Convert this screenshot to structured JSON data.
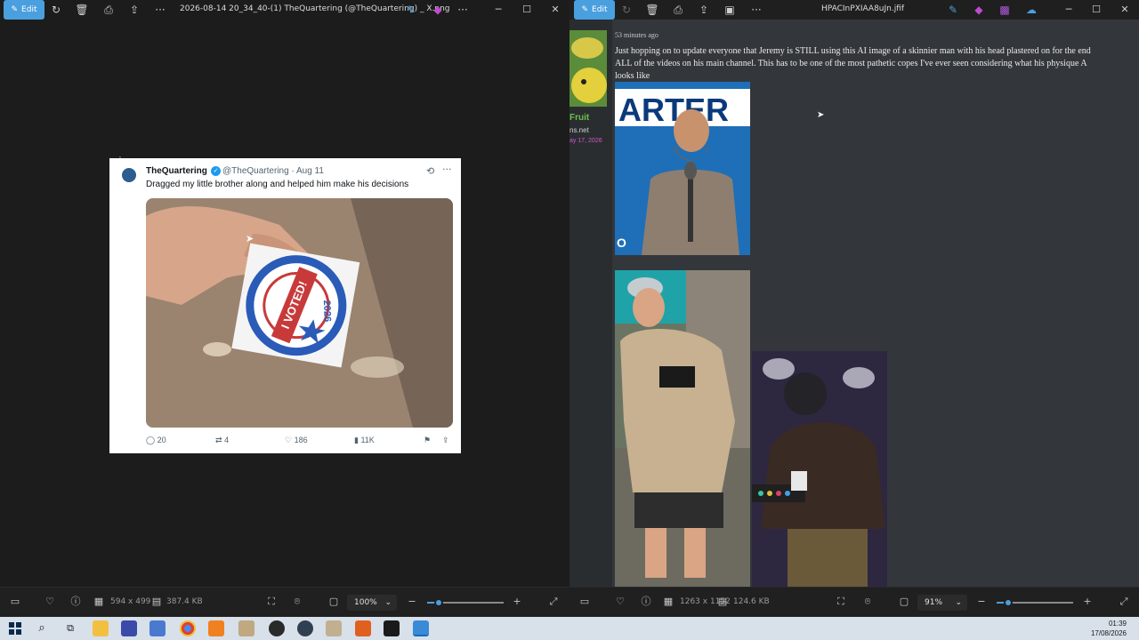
{
  "left_window": {
    "edit_label": "Edit",
    "title": "2026-08-14 20_34_40-(1) TheQuartering (@TheQuartering) _ X.png",
    "bottom": {
      "dimensions": "594 x 499",
      "filesize": "387.4 KB",
      "zoom": "100%"
    }
  },
  "tweet": {
    "name": "TheQuartering",
    "handle_date": "@TheQuartering · Aug 11",
    "text": "Dragged my little brother along and helped him make his decisions",
    "replies": "20",
    "retweets": "4",
    "likes": "186",
    "views": "11K",
    "sticker_text": "I VOTED!",
    "sticker_year": "2026"
  },
  "right_window": {
    "edit_label": "Edit",
    "title": "HPACInPXIAA8uJn.jfif",
    "bottom": {
      "dimensions": "1263 x 1152",
      "filesize": "124.6 KB",
      "zoom": "91%"
    }
  },
  "post": {
    "time": "53 minutes ago",
    "text": "Just hopping on to update everyone that Jeremy is STILL using this AI image of a skinnier man with his head plastered on for the end\nALL of the videos on his main channel. This has to be one of the most pathetic copes I've ever seen considering what his physique A\nlooks like",
    "user_name": "Fruit",
    "user_site": "ns.net",
    "user_date": "ay 17, 2026",
    "banner_text": "ARTER",
    "banner_tail": "O"
  },
  "taskbar": {
    "time": "01:39",
    "date": "17/08/2026"
  },
  "colors": {
    "accent": "#4a9fde",
    "verified": "#1d9bf0",
    "username": "#6cc04a",
    "user_date": "#d058c8"
  }
}
